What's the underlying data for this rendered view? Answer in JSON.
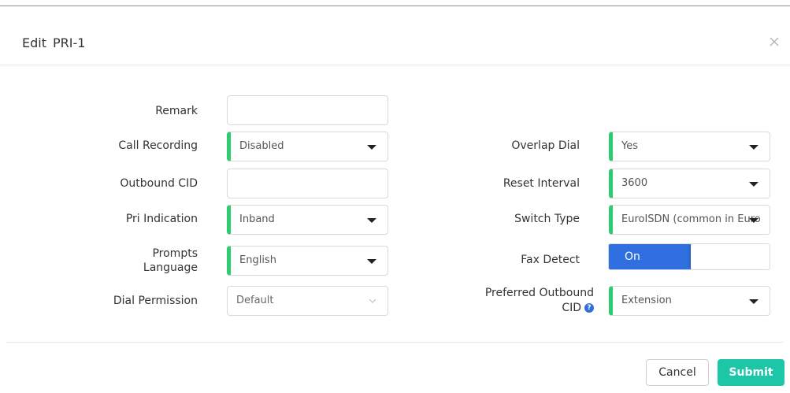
{
  "dialog": {
    "title_prefix": "Edit",
    "title_name": "PRI-1"
  },
  "left": {
    "remark": {
      "label": "Remark",
      "value": ""
    },
    "call_recording": {
      "label": "Call Recording",
      "value": "Disabled"
    },
    "outbound_cid": {
      "label": "Outbound CID",
      "value": ""
    },
    "pri_indication": {
      "label": "Pri Indication",
      "value": "Inband"
    },
    "prompts_language": {
      "label_line1": "Prompts",
      "label_line2": "Language",
      "value": "English"
    },
    "dial_permission": {
      "label": "Dial Permission",
      "value": "Default"
    }
  },
  "right": {
    "overlap_dial": {
      "label": "Overlap Dial",
      "value": "Yes"
    },
    "reset_interval": {
      "label": "Reset Interval",
      "value": "3600"
    },
    "switch_type": {
      "label": "Switch Type",
      "value": "EuroISDN (common in Euro"
    },
    "fax_detect": {
      "label": "Fax Detect",
      "state": "On"
    },
    "preferred_outbound_cid": {
      "label_line1": "Preferred Outbound",
      "label_line2": "CID",
      "value": "Extension"
    }
  },
  "buttons": {
    "cancel": "Cancel",
    "submit": "Submit"
  },
  "colors": {
    "required_marker": "#2ecc71",
    "toggle_on": "#2f6fe0",
    "submit": "#1cc6a6"
  }
}
